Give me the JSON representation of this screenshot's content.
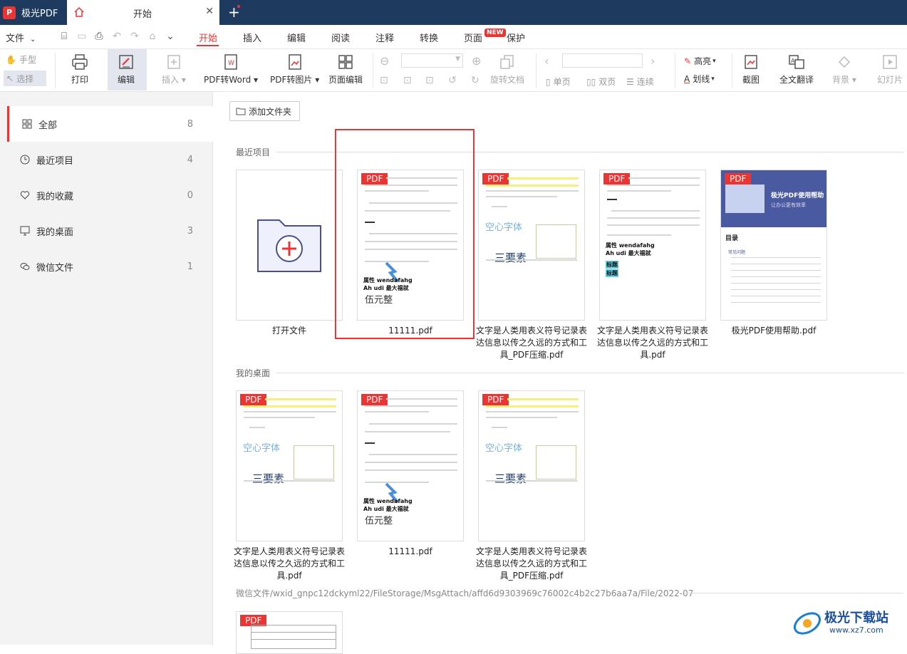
{
  "titlebar": {
    "app_name": "极光PDF",
    "tab_title": "开始",
    "close_glyph": "✕",
    "new_tab_glyph": "+"
  },
  "menubar": {
    "file_label": "文件",
    "tabs": [
      "开始",
      "插入",
      "编辑",
      "阅读",
      "注释",
      "转换",
      "页面",
      "保护"
    ],
    "active_tab": "开始",
    "new_badge": "NEW"
  },
  "toolbar": {
    "hand": "手型",
    "select": "选择",
    "print": "打印",
    "edit": "编辑",
    "insert": "插入",
    "pdf_to_word": "PDF转Word",
    "pdf_to_image": "PDF转图片",
    "page_edit": "页面编辑",
    "rotate_doc": "旋转文档",
    "single_page": "单页",
    "double_page": "双页",
    "continuous": "连续",
    "highlight": "高亮",
    "strikethrough": "划线",
    "screenshot": "截图",
    "full_translate": "全文翻译",
    "background": "背景",
    "slideshow": "幻灯片"
  },
  "sidebar": {
    "items": [
      {
        "label": "全部",
        "count": "8",
        "icon": "grid-icon"
      },
      {
        "label": "最近项目",
        "count": "4",
        "icon": "clock-icon"
      },
      {
        "label": "我的收藏",
        "count": "0",
        "icon": "heart-icon"
      },
      {
        "label": "我的桌面",
        "count": "3",
        "icon": "desktop-icon"
      },
      {
        "label": "微信文件",
        "count": "1",
        "icon": "wechat-icon"
      }
    ]
  },
  "main": {
    "add_folder": "添加文件夹",
    "pdf_tag": "PDF",
    "sections": {
      "recent": "最近项目",
      "desktop": "我的桌面",
      "wechat_path": "微信文件/wxid_gnpc12dckyml22/FileStorage/MsgAttach/affd6d9303969c76002c4b2c27b6aa7a/File/2022-07"
    },
    "recent_files": [
      "打开文件",
      "11111.pdf",
      "文字是人类用表义符号记录表达信息以传之久远的方式和工具_PDF压缩.pdf",
      "文字是人类用表义符号记录表达信息以传之久远的方式和工具.pdf",
      "极光PDF使用帮助.pdf"
    ],
    "desktop_files": [
      "文字是人类用表义符号记录表达信息以传之久远的方式和工具.pdf",
      "11111.pdf",
      "文字是人类用表义符号记录表达信息以传之久远的方式和工具_PDF压缩.pdf"
    ],
    "thumb_text": {
      "hollow_font": "空心字体",
      "three_elements": "三要素",
      "attr": "属性 wendafahg",
      "ahudi": "Ah udi 最大福就",
      "wuyuan": "伍元整",
      "biaoti": "标题",
      "help_title": "极光PDF使用帮助",
      "help_sub": "让办公更有效率",
      "toc": "目录",
      "faq": "常见问题"
    }
  },
  "watermark": {
    "text": "极光下载站",
    "url": "www.xz7.com"
  },
  "colors": {
    "accent": "#e33333",
    "titlebar": "#1f3a5f",
    "sidebar_bg": "#f3f3f3"
  }
}
